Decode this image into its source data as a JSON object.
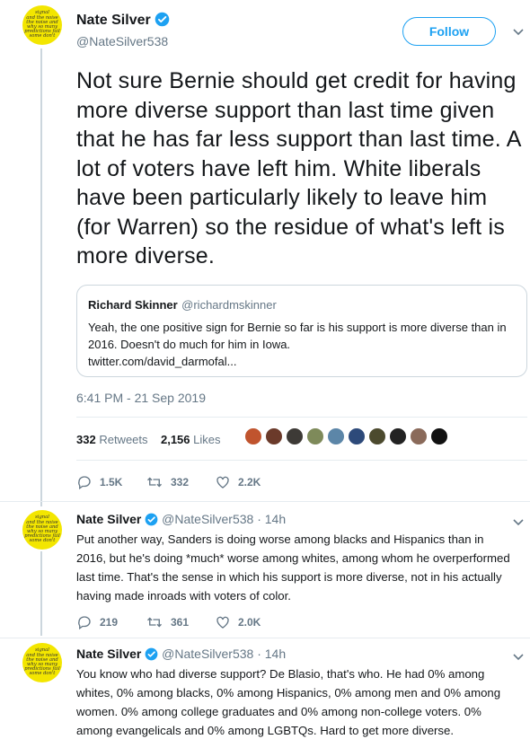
{
  "tweet": {
    "author_name": "Nate Silver",
    "author_handle": "@NateSilver538",
    "follow_label": "Follow",
    "text": "Not sure Bernie should get credit for having more diverse support than last time given that he has far less support than last time. A lot of voters have left him. White liberals have been particularly likely to leave him (for Warren) so the residue of what's left is more diverse.",
    "quote": {
      "author_name": "Richard Skinner",
      "author_handle": "@richardmskinner",
      "text": "Yeah, the one positive sign for Bernie so far is his support is more diverse than in 2016.  Doesn't do much for him in Iowa.",
      "link": "twitter.com/david_darmofal..."
    },
    "timestamp": "6:41 PM - 21 Sep 2019",
    "retweets_count": "332",
    "retweets_label": "Retweets",
    "likes_count": "2,156",
    "likes_label": "Likes",
    "actions": {
      "replies": "1.5K",
      "retweets": "332",
      "likes": "2.2K"
    }
  },
  "avatar_text": [
    "signal",
    "and the noise",
    "the noise and",
    "the noise and the",
    "why so many",
    "predictions fail",
    "some don't"
  ],
  "replies": [
    {
      "author_name": "Nate Silver",
      "author_handle": "@NateSilver538",
      "time": "14h",
      "separator": "·",
      "text": "Put another way, Sanders is doing worse among blacks and Hispanics than in 2016, but he's doing *much* worse among whites, among whom he overperformed last time. That's the sense in which his support is more diverse, not in his actually having made inroads with voters of color.",
      "actions": {
        "replies": "219",
        "retweets": "361",
        "likes": "2.0K"
      }
    },
    {
      "author_name": "Nate Silver",
      "author_handle": "@NateSilver538",
      "time": "14h",
      "separator": "·",
      "text": "You know who had diverse support? De Blasio, that's who. He had 0% among whites, 0% among blacks, 0% among Hispanics, 0% among men and 0% among women. 0% among college graduates and 0% among non-college voters. 0% among evangelicals and 0% among LGBTQs. Hard to get more diverse."
    }
  ],
  "likers": [
    {
      "name": "liker-avatar-1",
      "color": "#c0542e"
    },
    {
      "name": "liker-avatar-2",
      "color": "#6b3a2a"
    },
    {
      "name": "liker-avatar-3",
      "color": "#3d3a36"
    },
    {
      "name": "liker-avatar-4",
      "color": "#7e8a5a"
    },
    {
      "name": "liker-avatar-5",
      "color": "#5c86a8"
    },
    {
      "name": "liker-avatar-6",
      "color": "#2d4a7a"
    },
    {
      "name": "liker-avatar-7",
      "color": "#4c4a2e"
    },
    {
      "name": "liker-avatar-8",
      "color": "#222222"
    },
    {
      "name": "liker-avatar-9",
      "color": "#8a6a5a"
    },
    {
      "name": "liker-avatar-10",
      "color": "#111111"
    }
  ],
  "colors": {
    "accent": "#1da1f2",
    "text": "#14171a",
    "muted": "#657786",
    "avatar_bg": "#f3e600"
  },
  "icons": [
    "verified-badge-icon",
    "chevron-down-icon",
    "reply-icon",
    "retweet-icon",
    "like-icon"
  ]
}
